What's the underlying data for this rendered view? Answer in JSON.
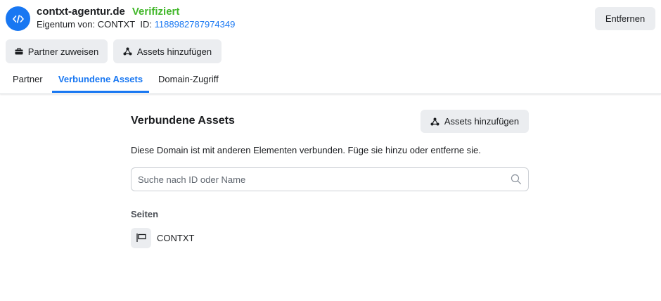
{
  "header": {
    "domain": "contxt-agentur.de",
    "status": "Verifiziert",
    "owner_label": "Eigentum von: CONTXT",
    "id_label": "ID:",
    "id_value": "1188982787974349",
    "remove_label": "Entfernen",
    "partner_assign_label": "Partner zuweisen",
    "add_assets_label": "Assets hinzufügen"
  },
  "tabs": [
    {
      "label": "Partner",
      "active": false
    },
    {
      "label": "Verbundene Assets",
      "active": true
    },
    {
      "label": "Domain-Zugriff",
      "active": false
    }
  ],
  "main": {
    "title": "Verbundene Assets",
    "add_assets_label": "Assets hinzufügen",
    "description": "Diese Domain ist mit anderen Elementen verbunden. Füge sie hinzu oder entferne sie.",
    "search_placeholder": "Suche nach ID oder Name",
    "groups": [
      {
        "label": "Seiten",
        "items": [
          {
            "name": "CONTXT",
            "icon": "flag-icon"
          }
        ]
      }
    ]
  },
  "colors": {
    "accent": "#1877f2",
    "verified": "#42b72a",
    "button_bg": "#ebedf0"
  }
}
